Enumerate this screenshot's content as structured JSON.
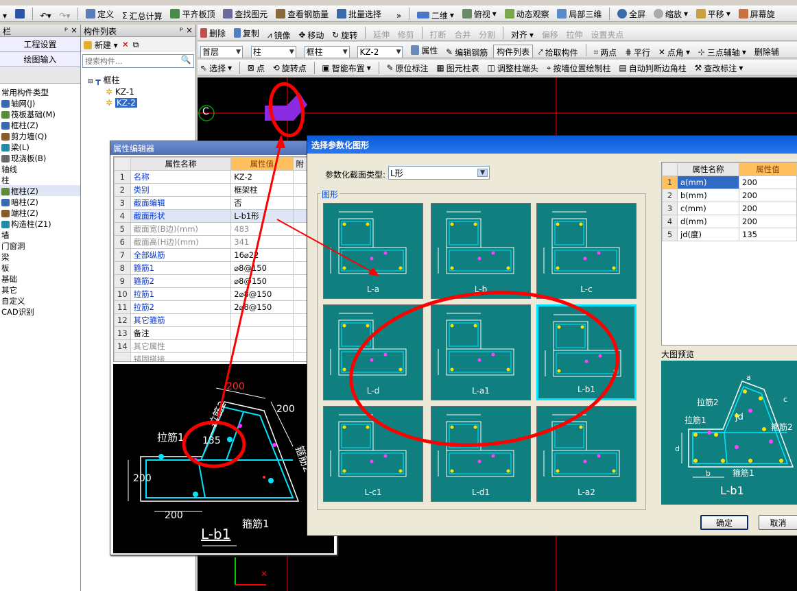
{
  "colors": {
    "accent": "#ff0000",
    "cad_bg": "#000000",
    "thumb_bg": "#0f7f7f",
    "selected": "#316ac5",
    "cyan": "#00e5ff"
  },
  "sidebar": {
    "title": "栏",
    "buttons": [
      "工程设置",
      "绘图输入"
    ],
    "tree": [
      "常用构件类型",
      "轴网(J)",
      "筏板基础(M)",
      "框柱(Z)",
      "剪力墙(Q)",
      "梁(L)",
      "现浇板(B)",
      "轴线",
      "柱",
      "框柱(Z)",
      "暗柱(Z)",
      "端柱(Z)",
      "构造柱(Z1)",
      "墙",
      "门窗洞",
      "梁",
      "板",
      "基础",
      "其它",
      "自定义",
      "CAD识别"
    ]
  },
  "complist": {
    "title": "构件列表",
    "new_label": "新建",
    "search_placeholder": "搜索构件...",
    "root": "框柱",
    "items": [
      "KZ-1",
      "KZ-2"
    ]
  },
  "toolbar1": [
    "定义",
    "汇总计算",
    "平齐板顶",
    "查找图元",
    "查看钢筋量",
    "批量选择",
    "二维",
    "俯视",
    "动态观察",
    "局部三维",
    "全屏",
    "缩放",
    "平移",
    "屏幕旋"
  ],
  "toolbar2": [
    "删除",
    "复制",
    "镜像",
    "移动",
    "旋转",
    "延伸",
    "修剪",
    "打断",
    "合并",
    "分割",
    "对齐",
    "偏移",
    "拉伸",
    "设置夹点"
  ],
  "toolbar3": {
    "selects": [
      "首层",
      "柱",
      "框柱",
      "KZ-2"
    ],
    "items": [
      "属性",
      "编辑钢筋",
      "构件列表",
      "拾取构件",
      "两点",
      "平行",
      "点角",
      "三点辅轴",
      "删除辅"
    ]
  },
  "toolbar4": [
    "选择",
    "点",
    "旋转点",
    "智能布置",
    "原位标注",
    "图元柱表",
    "调整柱端头",
    "按墙位置绘制柱",
    "自动判断边角柱",
    "查改标注"
  ],
  "axis_label": "C",
  "prop_editor": {
    "title": "属性编辑器",
    "col_name": "属性名称",
    "col_value": "属性值",
    "col_extra": "附",
    "rows": [
      {
        "n": "1",
        "name": "名称",
        "value": "KZ-2",
        "style": "blue"
      },
      {
        "n": "2",
        "name": "类别",
        "value": "框架柱",
        "style": "blue"
      },
      {
        "n": "3",
        "name": "截面编辑",
        "value": "否",
        "style": "blue"
      },
      {
        "n": "4",
        "name": "截面形状",
        "value": "L-b1形",
        "style": "blue"
      },
      {
        "n": "5",
        "name": "截面宽(B边)(mm)",
        "value": "483",
        "style": "grey"
      },
      {
        "n": "6",
        "name": "截面高(H边)(mm)",
        "value": "341",
        "style": "grey"
      },
      {
        "n": "7",
        "name": "全部纵筋",
        "value": "16⌀22",
        "style": "blue"
      },
      {
        "n": "8",
        "name": "箍筋1",
        "value": "⌀8@150",
        "style": "blue"
      },
      {
        "n": "9",
        "name": "箍筋2",
        "value": "⌀8@150",
        "style": "blue"
      },
      {
        "n": "10",
        "name": "拉筋1",
        "value": "2⌀8@150",
        "style": "blue"
      },
      {
        "n": "11",
        "name": "拉筋2",
        "value": "2⌀8@150",
        "style": "blue"
      },
      {
        "n": "12",
        "name": "其它箍筋",
        "value": "",
        "style": "blue"
      },
      {
        "n": "13",
        "name": "备注",
        "value": "",
        "style": "normal"
      },
      {
        "n": "14",
        "name": "其它属性",
        "value": "",
        "style": "grey"
      },
      {
        "n": "",
        "name": "锚固搭接",
        "value": "",
        "style": "grey"
      }
    ]
  },
  "preview_small": {
    "dim_a": "200",
    "dim_b": "200",
    "dim_c": "200",
    "dim_d": "200",
    "angle": "135",
    "lajin1": "拉筋1",
    "lajin2": "拉筋2",
    "gujin1": "箍筋1",
    "gujin2": "箍筋2",
    "label": "L-b1"
  },
  "dialog": {
    "title": "选择参数化图形",
    "type_label": "参数化截面类型:",
    "type_value": "L形",
    "group_label": "图形",
    "thumbs": [
      "L-a",
      "L-b",
      "L-c",
      "L-d",
      "L-a1",
      "L-b1",
      "L-c1",
      "L-d1",
      "L-a2"
    ],
    "selected_thumb": "L-b1",
    "param_header": {
      "name": "属性名称",
      "value": "属性值"
    },
    "params": [
      {
        "n": "1",
        "name": "a(mm)",
        "value": "200"
      },
      {
        "n": "2",
        "name": "b(mm)",
        "value": "200"
      },
      {
        "n": "3",
        "name": "c(mm)",
        "value": "200"
      },
      {
        "n": "4",
        "name": "d(mm)",
        "value": "200"
      },
      {
        "n": "5",
        "name": "jd(度)",
        "value": "135"
      }
    ],
    "preview_label": "大图预览",
    "preview_labels": {
      "lajin2": "拉筋2",
      "lajin1": "拉筋1",
      "jd": "jd",
      "gujin2": "箍筋2",
      "gujin1": "箍筋1",
      "a": "a",
      "b": "b",
      "c": "c",
      "d": "d",
      "name": "L-b1"
    },
    "ok": "确定",
    "cancel": "取消"
  }
}
